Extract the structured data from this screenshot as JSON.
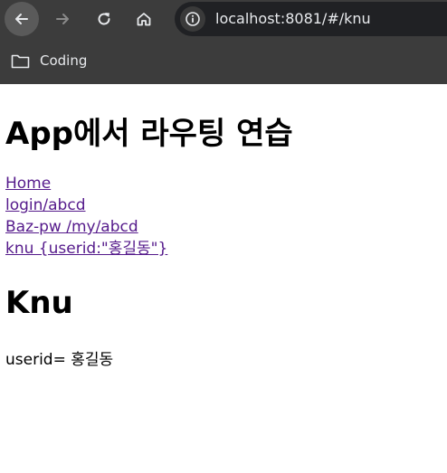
{
  "browser": {
    "url": "localhost:8081/#/knu",
    "bookmark_folder": "Coding"
  },
  "page": {
    "title": "App에서 라우팅 연습",
    "links": [
      "Home",
      "login/abcd",
      "Baz-pw /my/abcd",
      "knu {userid:\"홍길동\"}"
    ],
    "section_title": "Knu",
    "userid_label": "userid=",
    "userid_value": "홍길동"
  }
}
